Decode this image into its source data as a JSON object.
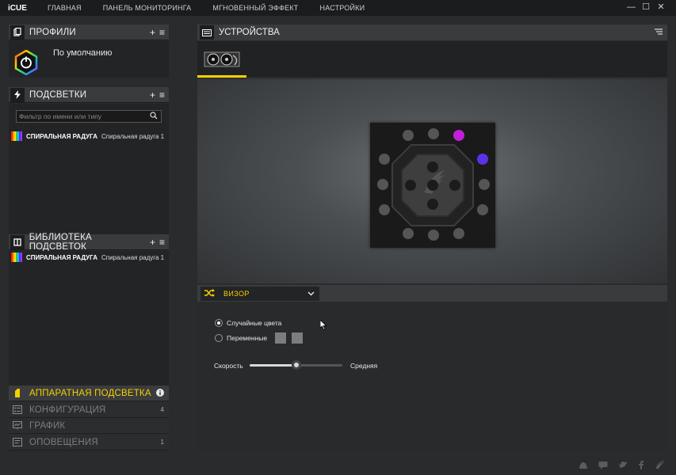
{
  "app": {
    "title": "iCUE"
  },
  "topnav": [
    "ГЛАВНАЯ",
    "ПАНЕЛЬ МОНИТОРИНГА",
    "МГНОВЕННЫЙ ЭФФЕКТ",
    "НАСТРОЙКИ"
  ],
  "window_controls": {
    "minimize": "—",
    "maximize": "☐",
    "close": "✕"
  },
  "profiles": {
    "title": "ПРОФИЛИ",
    "add": "+",
    "menu": "≡",
    "current": "По умолчанию"
  },
  "lighting": {
    "title": "ПОДСВЕТКИ",
    "add": "+",
    "menu": "≡",
    "filter_placeholder": "Фильтр по имени или типу",
    "items": [
      {
        "name": "СПИРАЛЬНАЯ РАДУГА",
        "type": "Спиральная радуга 1"
      }
    ]
  },
  "library": {
    "title": "БИБЛИОТЕКА ПОДСВЕТОК",
    "add": "+",
    "menu": "≡",
    "items": [
      {
        "name": "СПИРАЛЬНАЯ РАДУГА",
        "type": "Спиральная радуга 1"
      }
    ]
  },
  "bottom_menu": [
    {
      "label": "АППАРАТНАЯ ПОДСВЕТКА",
      "count": "",
      "active": true,
      "icon": "hardware-lighting-icon"
    },
    {
      "label": "КОНФИГУРАЦИЯ",
      "count": "4",
      "active": false,
      "icon": "configuration-icon"
    },
    {
      "label": "ГРАФИК",
      "count": "",
      "active": false,
      "icon": "graph-icon"
    },
    {
      "label": "ОПОВЕЩЕНИЯ",
      "count": "1",
      "active": false,
      "icon": "notifications-icon"
    }
  ],
  "devices": {
    "title": "УСТРОЙСТВА"
  },
  "effect": {
    "selected": "ВИЗОР",
    "options": [
      {
        "label": "Случайные цвета",
        "selected": true
      },
      {
        "label": "Переменные",
        "selected": false
      }
    ],
    "swatch_colors": [
      "#7d7d7d",
      "#7d7d7d"
    ],
    "speed_label": "Скорость",
    "speed_value": "Средняя",
    "speed_fraction": 0.5
  },
  "preview": {
    "led_off_color": "#555555",
    "leds_lit": [
      {
        "index": 2,
        "color": "#c020d8"
      },
      {
        "index": 3,
        "color": "#5a32e8"
      }
    ]
  },
  "colors": {
    "accent": "#f4d000"
  }
}
